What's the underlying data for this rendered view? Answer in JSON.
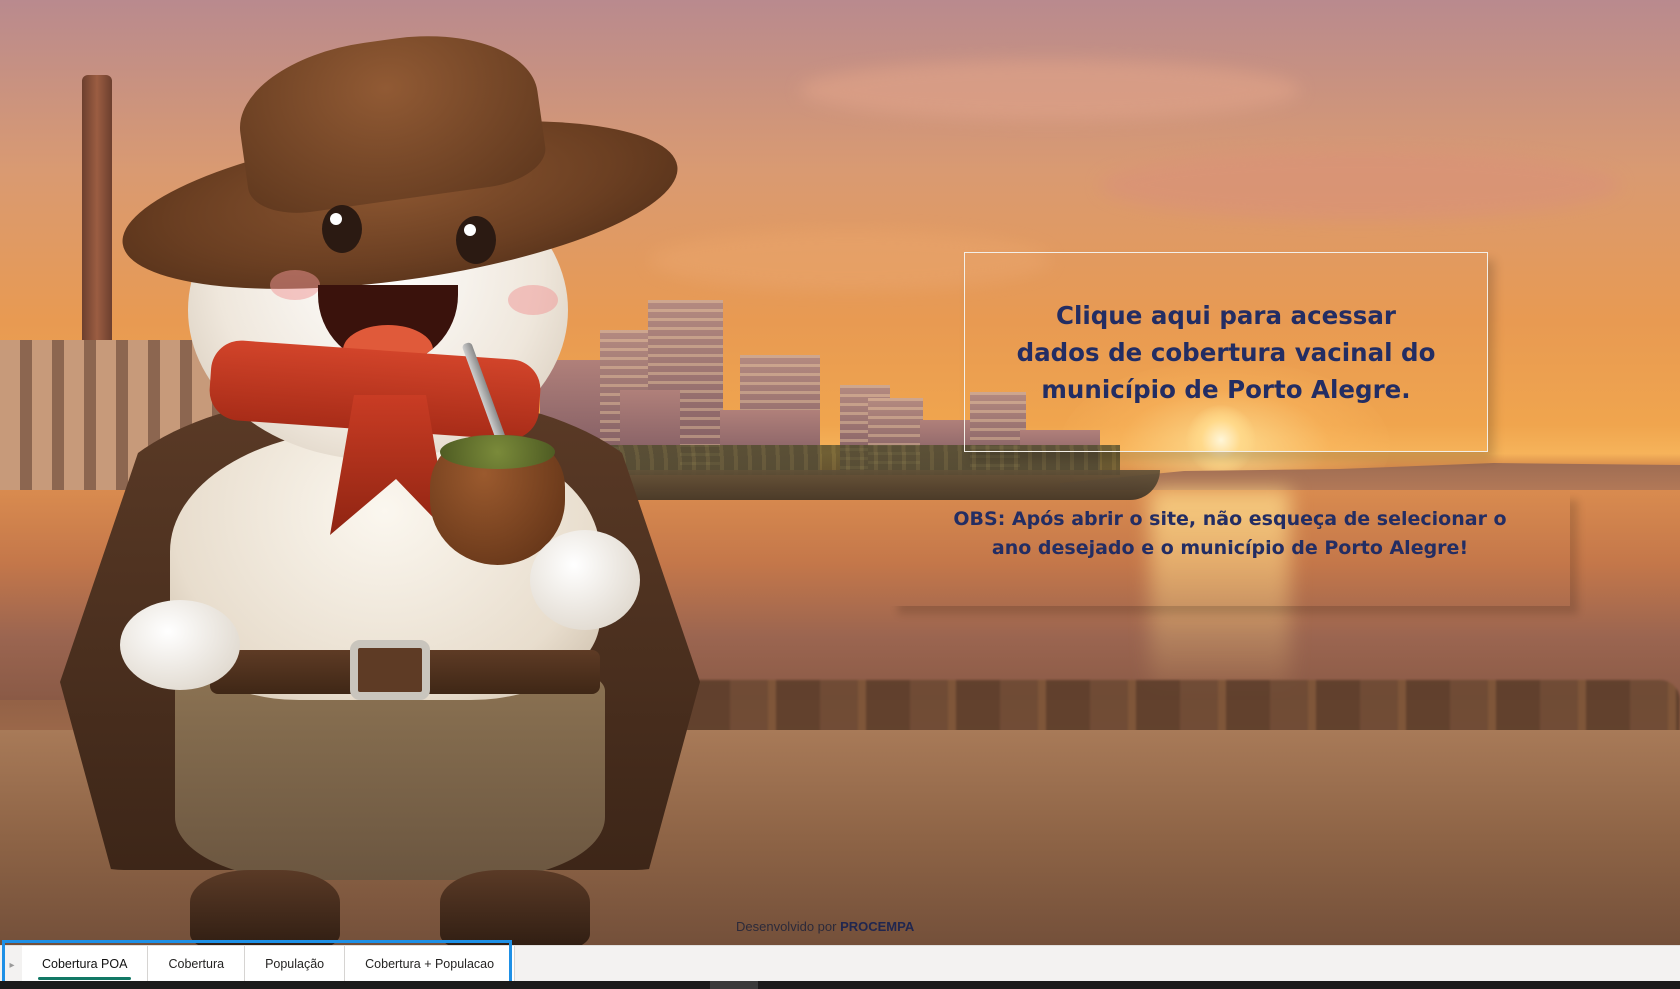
{
  "main": {
    "link_text": "Clique aqui para acessar dados de cobertura vacinal do município de Porto Alegre.",
    "obs_text": "OBS: Após abrir o site, não esqueça de selecionar o ano desejado e o município de Porto Alegre!",
    "credit_prefix": "Desenvolvido por",
    "credit_brand": "PROCEMPA"
  },
  "tabs": [
    {
      "label": "Cobertura POA",
      "active": true
    },
    {
      "label": "Cobertura",
      "active": false
    },
    {
      "label": "População",
      "active": false
    },
    {
      "label": "Cobertura + Populacao",
      "active": false
    }
  ],
  "icons": {
    "tab_scroll": "chevron-right-icon"
  },
  "colors": {
    "text_accent": "#232d63",
    "tab_active_underline": "#117865",
    "selection_frame": "#1e90e6"
  }
}
